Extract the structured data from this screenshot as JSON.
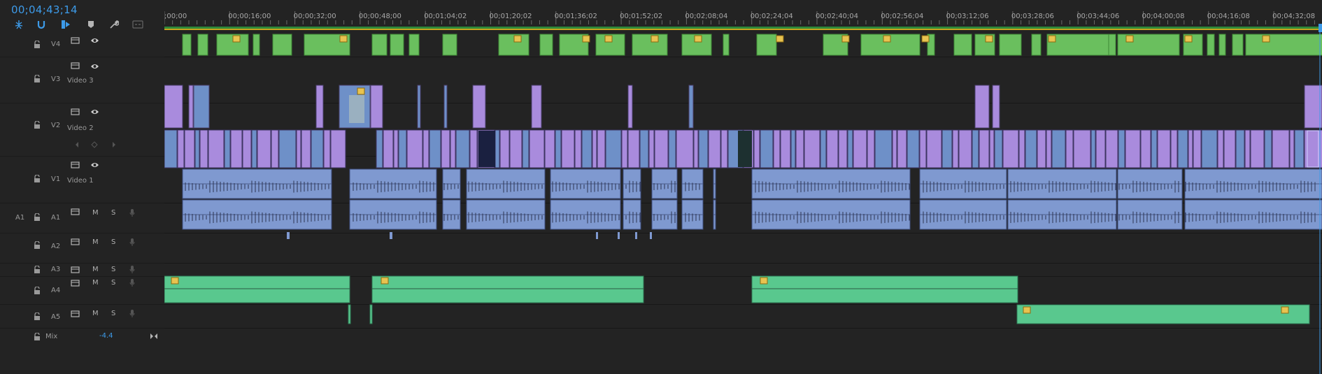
{
  "timecode": "00;04;43;14",
  "ruler": {
    "labels": [
      ";00;00",
      "00;00;16;00",
      "00;00;32;00",
      "00;00;48;00",
      "00;01;04;02",
      "00;01;20;02",
      "00;01;36;02",
      "00;01;52;02",
      "00;02;08;04",
      "00;02;24;04",
      "00;02;40;04",
      "00;02;56;04",
      "00;03;12;06",
      "00;03;28;06",
      "00;03;44;06",
      "00;04;00;08",
      "00;04;16;08",
      "00;04;32;08"
    ]
  },
  "toolbar": [
    {
      "name": "snap-icon"
    },
    {
      "name": "linked-selection-icon"
    },
    {
      "name": "insert-overwrite-icon"
    },
    {
      "name": "marker-icon"
    },
    {
      "name": "wrench-icon"
    },
    {
      "name": "captions-icon"
    }
  ],
  "tracks": {
    "V4": {
      "id": "V4",
      "name": ""
    },
    "V3": {
      "id": "V3",
      "name": "Video 3"
    },
    "V2": {
      "id": "V2",
      "name": "Video 2"
    },
    "V1": {
      "id": "V1",
      "name": "Video 1"
    },
    "A1": {
      "source": "A1",
      "id": "A1",
      "m": "M",
      "s": "S"
    },
    "A2": {
      "id": "A2",
      "m": "M",
      "s": "S"
    },
    "A3": {
      "id": "A3",
      "m": "M",
      "s": "S"
    },
    "A4": {
      "id": "A4",
      "m": "M",
      "s": "S"
    },
    "A5": {
      "id": "A5",
      "m": "M",
      "s": "S"
    },
    "Mix": {
      "id": "Mix",
      "value": "-4.4"
    }
  },
  "colors": {
    "v4_clip": "#6abf5e",
    "video_violet": "#a98bdd",
    "video_blue": "#6e90c8",
    "audio_blue": "#7f99d0",
    "audio_green": "#59c88e",
    "accent": "#3d9be9",
    "fx_badge": "#e8c350"
  }
}
